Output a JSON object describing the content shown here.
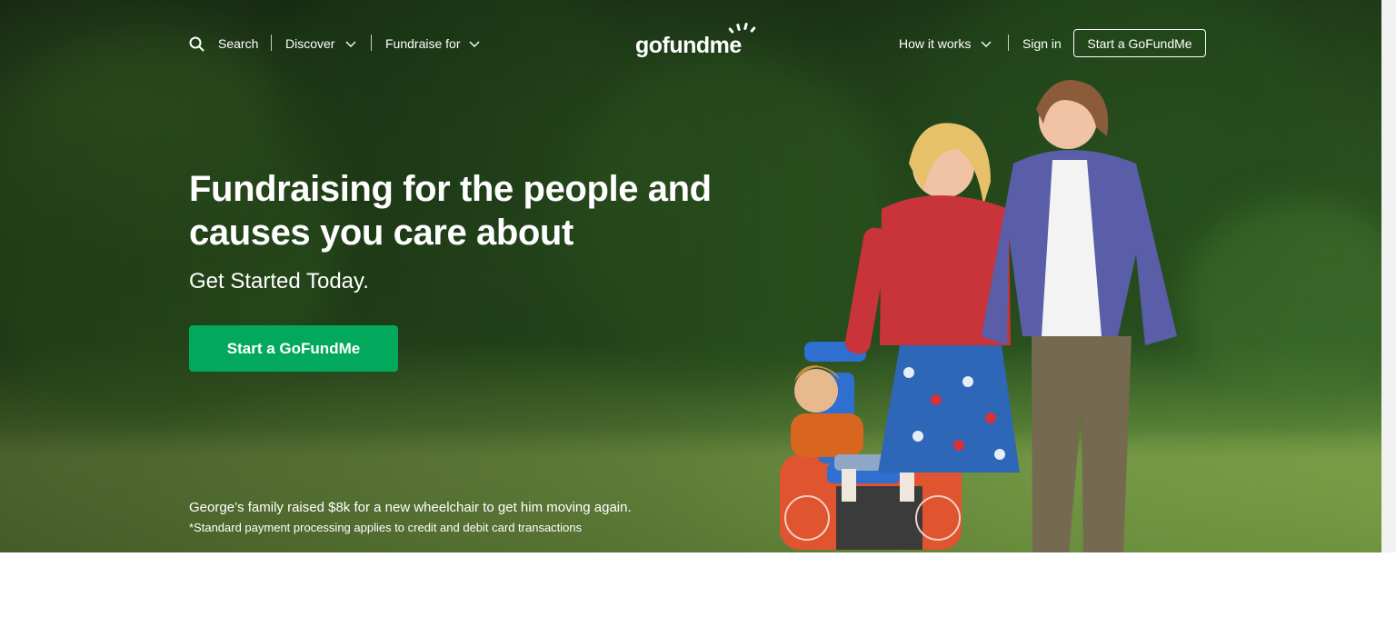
{
  "nav": {
    "search_label": "Search",
    "discover_label": "Discover",
    "fundraise_label": "Fundraise for",
    "how_it_works_label": "How it works",
    "sign_in_label": "Sign in",
    "start_label": "Start a GoFundMe"
  },
  "logo": {
    "text": "gofundme"
  },
  "hero": {
    "headline_line1": "Fundraising for the people and",
    "headline_line2": "causes you care about",
    "subheadline": "Get Started Today.",
    "cta_label": "Start a GoFundMe",
    "caption": "George’s family raised $8k for a new wheelchair to get him moving again.",
    "disclaimer": "*Standard payment processing applies to credit and debit card transactions"
  },
  "colors": {
    "brand_green": "#02a95c",
    "text_white": "#ffffff",
    "page_background": "#ffffff"
  },
  "icons": [
    "search-icon",
    "chevron-down-icon",
    "gofundme-logo-sunburst-icon"
  ]
}
